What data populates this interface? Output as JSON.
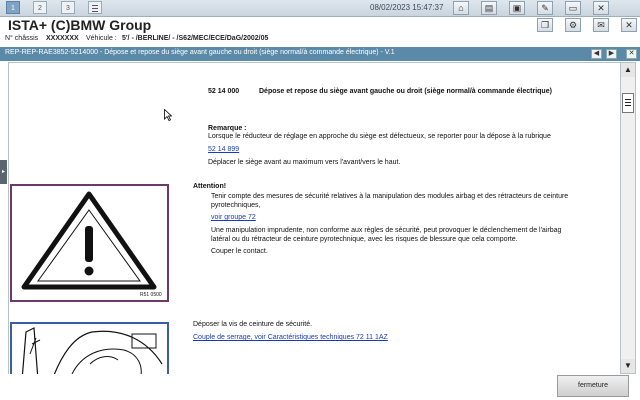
{
  "topbar": {
    "tabs": [
      "1",
      "2",
      "3"
    ],
    "datetime": "08/02/2023 15:47:37",
    "icons": [
      "home-icon",
      "id-card-icon",
      "image-icon",
      "wrench-icon",
      "save-icon",
      "close-icon"
    ]
  },
  "appbar": {
    "title": "ISTA+ (C)BMW Group",
    "icons": [
      "copy-icon",
      "gear-icon",
      "mail-icon",
      "close-icon"
    ]
  },
  "vehicle": {
    "chassis_label": "N° châssis",
    "chassis_value": "XXXXXXX",
    "vehicle_label": "Véhicule :",
    "vehicle_value": "5'/ - /BERLINE/ - /S62/MEC/ECE/DaG/2002/05"
  },
  "document": {
    "title": "REP-REP-RAE3852-5214000 - Dépose et repose du siège avant gauche ou droit (siège normal/à commande électrique) - V.1",
    "code": "52 14 000",
    "heading": "Dépose et repose du siège avant gauche ou droit (siège normal/à commande électrique)",
    "remark_label": "Remarque :",
    "remark_text": "Lorsque le réducteur de réglage en approche du siège est défectueux, se reporter pour la dépose à la rubrique",
    "remark_link": "52 14 899",
    "remark_text2": "Déplacer le siège avant au maximum vers l'avant/vers le haut.",
    "attention_label": "Attention!",
    "attention_line1": "Tenir compte des mesures de sécurité relatives à la manipulation des modules airbag et des rétracteurs de ceinture",
    "attention_line2": "pyrotechniques,",
    "attention_link": "voir groupe 72",
    "attention_line3": "Une manipulation imprudente, non conforme aux règles de sécurité, peut provoquer le déclenchement de l'airbag",
    "attention_line4": "latéral ou du rétracteur de ceinture pyrotechnique, avec les risques de blessure que cela comporte.",
    "attention_line5": "Couper le contact.",
    "warning_image_caption": "R51 0500",
    "step_text": "Déposer la vis de ceinture de sécurité.",
    "step_link": "Couple de serrage, voir Caractéristiques techniques 72 11 1AZ"
  },
  "footer": {
    "close_label": "fermeture"
  }
}
